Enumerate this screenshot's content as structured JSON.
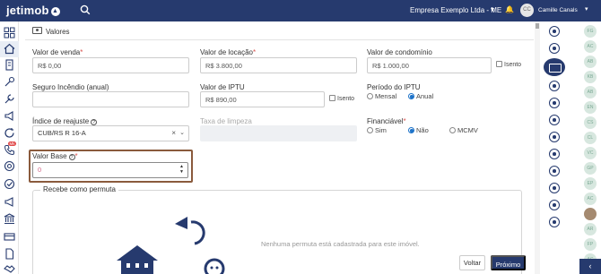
{
  "topbar": {
    "logo_text": "jetimob",
    "company": "Empresa Exemplo Ltda - ME",
    "user_initials": "CC",
    "user_name": "Camille Canals",
    "colors": {
      "bar": "#263a6e"
    }
  },
  "sidebar": {
    "badge": "Mk",
    "icons": [
      "grid-icon",
      "home-icon",
      "building-icon",
      "key-icon",
      "tools-icon",
      "announcements-icon",
      "refresh-icon",
      "phone-icon",
      "target-icon",
      "check-circle-icon",
      "megaphone-icon",
      "bank-icon",
      "card-icon",
      "document-icon",
      "handshake-icon",
      "settings-icon"
    ]
  },
  "section": {
    "title": "Valores"
  },
  "fields": {
    "valor_venda": {
      "label": "Valor de venda",
      "required": "*",
      "value": "R$ 0,00"
    },
    "valor_locacao": {
      "label": "Valor de locação",
      "required": "*",
      "value": "R$ 3.800,00"
    },
    "valor_condominio": {
      "label": "Valor de condomínio",
      "value": "R$ 1.000,00",
      "isento_label": "Isento"
    },
    "seguro_incendio": {
      "label": "Seguro Incêndio (anual)",
      "value": ""
    },
    "valor_iptu": {
      "label": "Valor de IPTU",
      "value": "R$ 890,00",
      "isento_label": "Isento"
    },
    "periodo_iptu": {
      "label": "Período do IPTU",
      "options": [
        "Mensal",
        "Anual"
      ],
      "selected": "Anual"
    },
    "indice_reajuste": {
      "label": "Índice de reajuste",
      "help": "?",
      "value": "CUB/RS R 16-A",
      "clear": "×",
      "chevron": "⌄"
    },
    "taxa_limpeza": {
      "label": "Taxa de limpeza"
    },
    "financiavel": {
      "label": "Financiável",
      "required": "*",
      "options": [
        "Sim",
        "Não",
        "MCMV"
      ],
      "selected": "Não"
    },
    "valor_base": {
      "label": "Valor Base",
      "help": "?",
      "required": "*",
      "value": "0"
    }
  },
  "permuta": {
    "title": "Recebe como permuta",
    "empty_text": "Nenhuma permuta está cadastrada para este imóvel."
  },
  "actions": {
    "back": "Voltar",
    "next": "Próximo"
  },
  "right_rail": {
    "icons": [
      "map-pin-icon",
      "location-icon",
      "money-icon",
      "eye-icon",
      "thermometer-icon",
      "key-icon",
      "camera-icon",
      "play-icon",
      "document-icon",
      "clipboard-icon",
      "list-icon",
      "megaphone-icon"
    ]
  },
  "avatars": [
    "FG",
    "AC",
    "AB",
    "KB",
    "AB",
    "EN",
    "CS",
    "CL",
    "VC",
    "GP",
    "EP",
    "AC",
    "AR",
    "FP",
    "AC"
  ],
  "collapse": {
    "label": "‹"
  }
}
